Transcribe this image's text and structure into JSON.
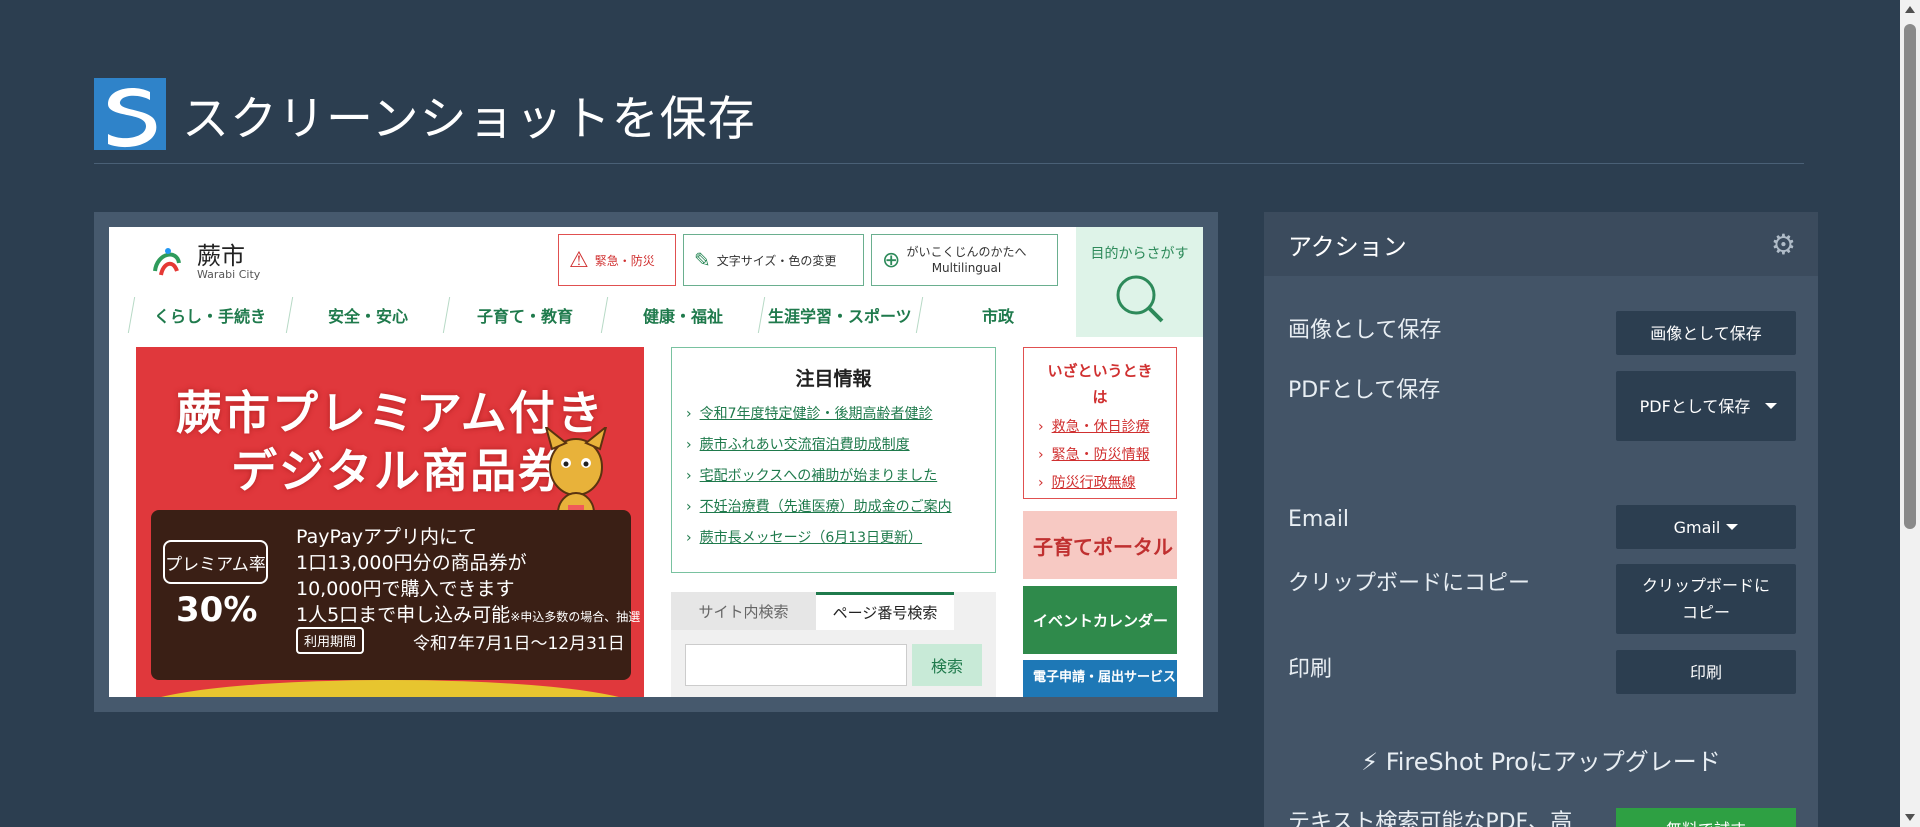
{
  "header": {
    "title": "スクリーンショットを保存",
    "logo_icon": "fireshot-logo-icon"
  },
  "preview": {
    "site": {
      "city_name": "蕨市",
      "city_name_en": "Warabi City",
      "top_buttons": [
        "緊急・防災",
        "文字サイズ・色の変更",
        "がいこくじんのかたへ",
        "Multilingual"
      ],
      "search_corner_label": "目的からさがす",
      "nav": [
        "くらし・手続き",
        "安全・安心",
        "子育て・教育",
        "健康・福祉",
        "生涯学習・スポーツ",
        "市政"
      ]
    },
    "banner": {
      "title_line1": "蕨市プレミアム付き",
      "title_line2": "デジタル商品券",
      "rate_label": "プレミアム率",
      "rate_value": "30%",
      "line1": "PayPayアプリ内にて",
      "line2": "1口13,000円分の商品券が",
      "line3": "10,000円で購入できます",
      "line4": "1人5口まで申し込み可能",
      "line4_note": "※申込多数の場合、抽選",
      "period_label": "利用期間",
      "period_text": "令和7年7月1日～12月31日"
    },
    "notice": {
      "title": "注目情報",
      "items": [
        "令和7年度特定健診・後期高齢者健診",
        "蕨市ふれあい交流宿泊費助成制度",
        "宅配ボックスへの補助が始まりました",
        "不妊治療費（先進医療）助成金のご案内",
        "蕨市長メッセージ（6月13日更新）"
      ]
    },
    "search": {
      "tab1": "サイト内検索",
      "tab2": "ページ番号検索",
      "button": "検索"
    },
    "emergency": {
      "title": "いざというとき",
      "title2": "は",
      "items": [
        "救急・休日診療",
        "緊急・防災情報",
        "防災行政無線"
      ]
    },
    "side_banners": [
      "子育てポータル",
      "イベントカレンダー",
      "電子申請・届出サービス"
    ]
  },
  "actions": {
    "title": "アクション",
    "rows": [
      {
        "label": "画像として保存",
        "button": "画像として保存"
      },
      {
        "label": "PDFとして保存",
        "button": "PDFとして保存"
      },
      {
        "label": "Email",
        "button": "Gmail"
      },
      {
        "label": "クリップボードにコピー",
        "button": "クリップボードにコピー"
      },
      {
        "label": "印刷",
        "button": "印刷"
      }
    ],
    "upgrade": "FireShot Proにアップグレード",
    "bottom_text": "テキスト検索可能なPDF、高",
    "green_button": "無料で試す"
  },
  "colors": {
    "background": "#2c3e50",
    "panel": "#435467",
    "accent_green": "#2ea043",
    "site_green": "#1f7a4c",
    "banner_red": "#e0383c"
  }
}
